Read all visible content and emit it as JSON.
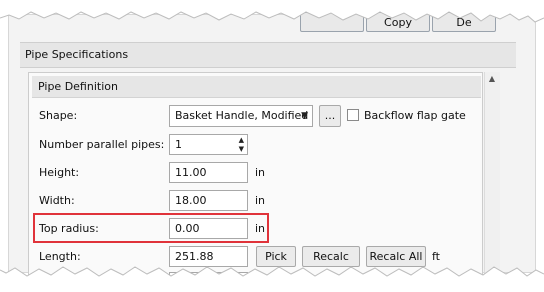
{
  "top_buttons": {
    "copy": "Copy",
    "delete": "De"
  },
  "pipe_specifications": {
    "title": "Pipe Specifications"
  },
  "pipe_definition": {
    "title": "Pipe Definition",
    "shape": {
      "label": "Shape:",
      "value": "Basket Handle, Modified",
      "browse_label": "...",
      "backflow_label": "Backflow flap gate",
      "backflow_checked": false
    },
    "parallel_pipes": {
      "label": "Number parallel pipes:",
      "value": "1"
    },
    "height": {
      "label": "Height:",
      "value": "11.00",
      "unit": "in"
    },
    "width": {
      "label": "Width:",
      "value": "18.00",
      "unit": "in"
    },
    "top_radius": {
      "label": "Top radius:",
      "value": "0.00",
      "unit": "in"
    },
    "length": {
      "label": "Length:",
      "value": "251.88",
      "unit": "ft",
      "pick_label": "Pick",
      "recalc_label": "Recalc",
      "recalc_all_label": "Recalc All"
    }
  },
  "colors": {
    "highlight": "#e0333a"
  }
}
